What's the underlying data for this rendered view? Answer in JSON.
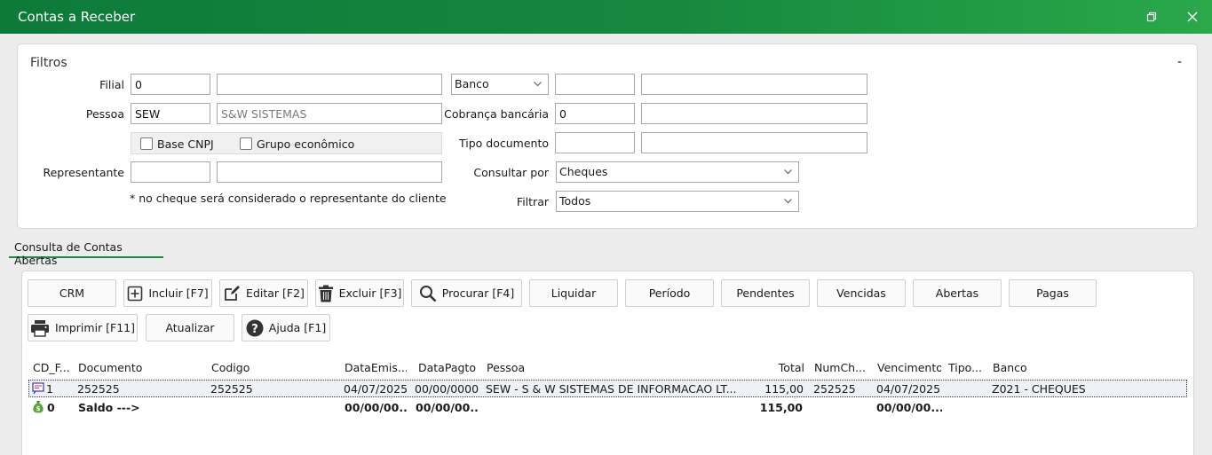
{
  "window": {
    "title": "Contas a Receber"
  },
  "filtros": {
    "title": "Filtros",
    "collapse": "-",
    "filial": {
      "label": "Filial",
      "code": "0",
      "name": ""
    },
    "pessoa": {
      "label": "Pessoa",
      "code": "SEW",
      "name": "S&W SISTEMAS"
    },
    "base_cnpj": "Base CNPJ",
    "grupo": "Grupo econômico",
    "representante": {
      "label": "Representante",
      "code": "",
      "name": ""
    },
    "note": "* no cheque será considerado o representante do cliente",
    "banco": {
      "selected": "Banco",
      "code": "",
      "name": ""
    },
    "cobranca": {
      "label": "Cobrança bancária",
      "code": "0",
      "name": ""
    },
    "tipo_doc": {
      "label": "Tipo documento",
      "code": "",
      "name": ""
    },
    "consultar": {
      "label": "Consultar por",
      "value": "Cheques"
    },
    "filtrar": {
      "label": "Filtrar",
      "value": "Todos"
    }
  },
  "tab": "Consulta de Contas Abertas",
  "toolbar": {
    "crm": "CRM",
    "incluir": "Incluir [F7]",
    "editar": "Editar [F2]",
    "excluir": "Excluir [F3]",
    "procurar": "Procurar [F4]",
    "liquidar": "Liquidar",
    "periodo": "Período",
    "pendentes": "Pendentes",
    "vencidas": "Vencidas",
    "abertas": "Abertas",
    "pagas": "Pagas",
    "imprimir": "Imprimir [F11]",
    "atualizar": "Atualizar",
    "ajuda": "Ajuda [F1]"
  },
  "grid": {
    "headers": [
      "CD_F...",
      "Documento",
      "Codigo",
      "DataEmis...",
      "DataPagto",
      "Pessoa",
      "Total",
      "NumCh...",
      "Vencimento",
      "Tipo...",
      "Banco"
    ],
    "rows": [
      [
        "1",
        "252525",
        "252525",
        "04/07/2025",
        "00/00/0000",
        "SEW - S & W SISTEMAS DE INFORMACAO LT...",
        "115,00",
        "252525",
        "04/07/2025",
        "",
        "Z021 - CHEQUES"
      ]
    ],
    "total": [
      "0",
      "Saldo --->",
      "",
      "00/00/00...",
      "00/00/00...",
      "",
      "115,00",
      "",
      "00/00/00...",
      "",
      ""
    ]
  },
  "colors": {
    "accent": "#1f8a45",
    "title_gradient_start": "#0d7a3a",
    "title_gradient_end": "#2aa84a"
  }
}
